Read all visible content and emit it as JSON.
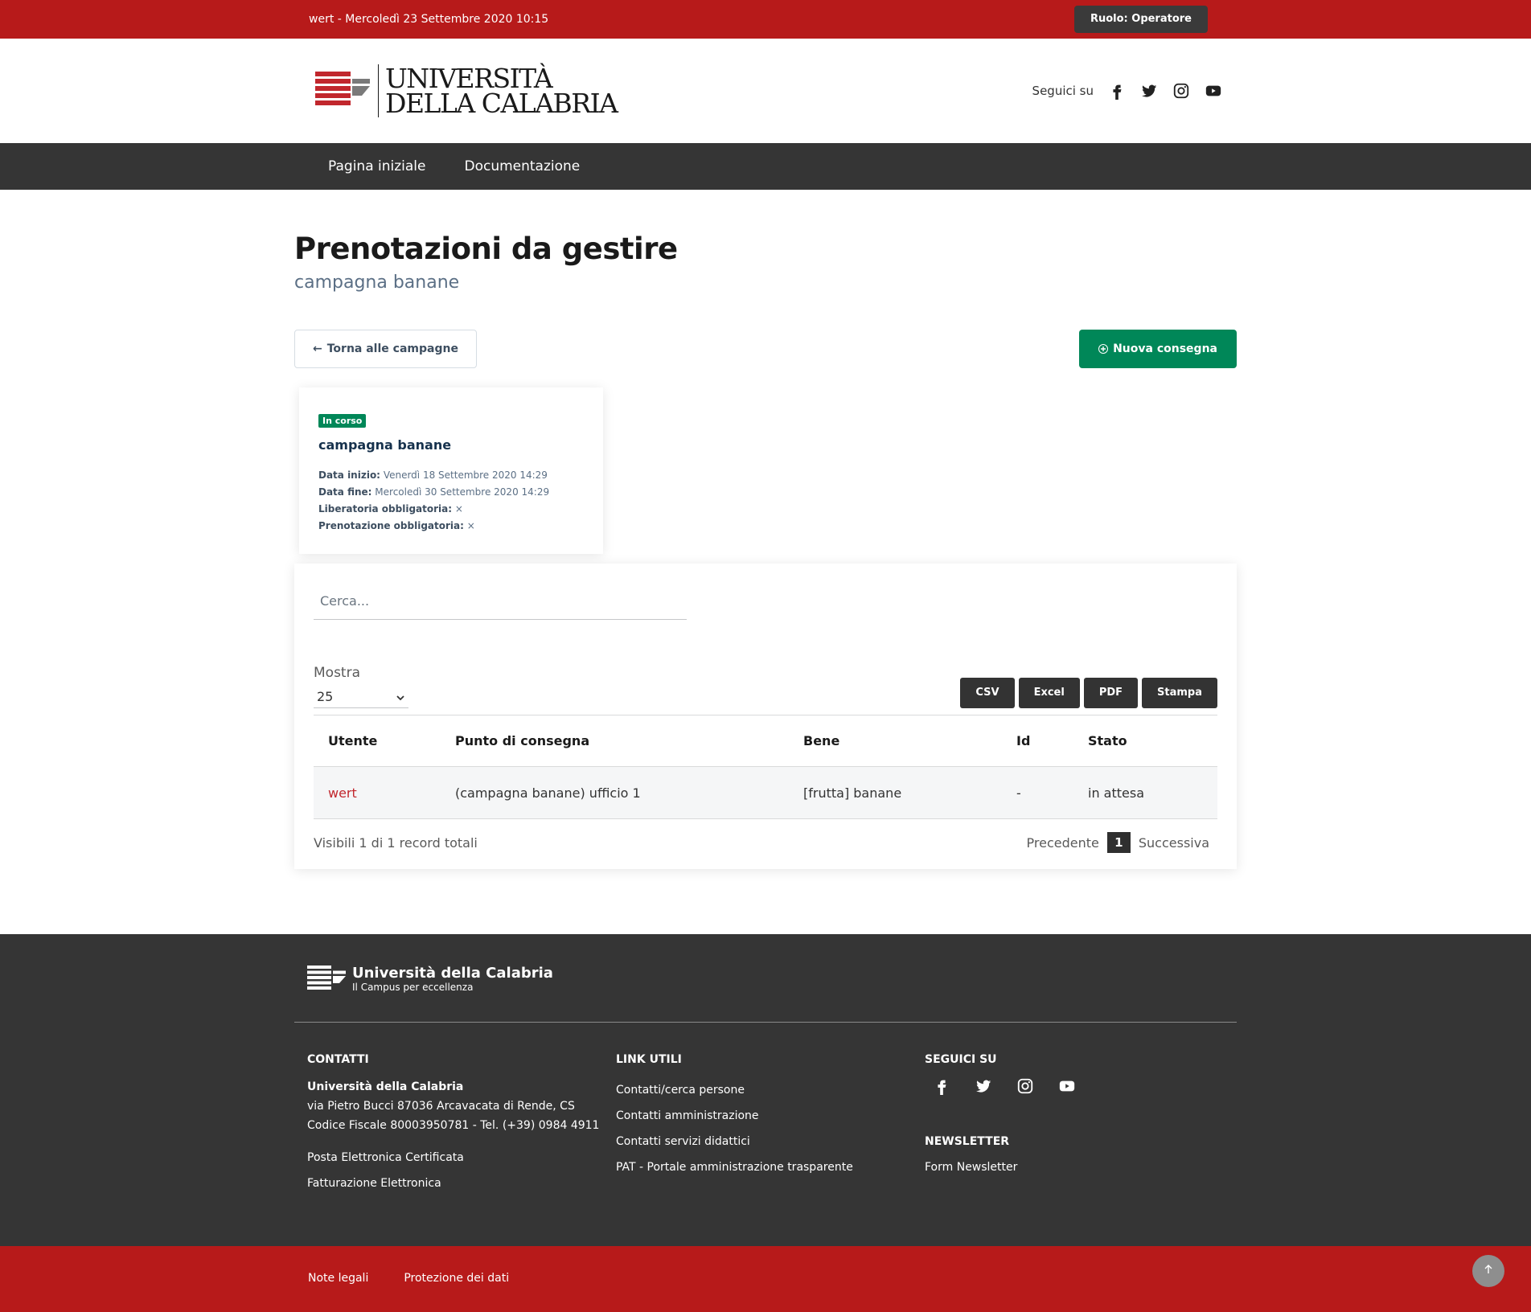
{
  "topbar": {
    "datetime": "wert - Mercoledì 23 Settembre 2020 10:15",
    "role": "Ruolo: Operatore"
  },
  "header": {
    "logo_line1": "UNIVERSITÀ",
    "logo_line2": "DELLA CALABRIA",
    "follow_label": "Seguici su",
    "social_icons": [
      "facebook-icon",
      "twitter-icon",
      "instagram-icon",
      "youtube-icon"
    ]
  },
  "nav": {
    "items": [
      {
        "label": "Pagina iniziale"
      },
      {
        "label": "Documentazione"
      }
    ]
  },
  "page": {
    "title": "Prenotazioni da gestire",
    "subtitle": "campagna banane",
    "back_label": "Torna alle campagne",
    "new_label": "Nuova consegna"
  },
  "campaign": {
    "badge": "In corso",
    "title": "campagna banane",
    "start_label": "Data inizio:",
    "start_value": "Venerdì 18 Settembre 2020 14:29",
    "end_label": "Data fine:",
    "end_value": "Mercoledì 30 Settembre 2020 14:29",
    "liberatoria_label": "Liberatoria obbligatoria:",
    "liberatoria_value": "×",
    "prenotazione_label": "Prenotazione obbligatoria:",
    "prenotazione_value": "×"
  },
  "table": {
    "search_placeholder": "Cerca...",
    "show_label": "Mostra",
    "show_value": "25",
    "export": [
      "CSV",
      "Excel",
      "PDF",
      "Stampa"
    ],
    "columns": [
      "Utente",
      "Punto di consegna",
      "Bene",
      "Id",
      "Stato"
    ],
    "rows": [
      [
        "wert",
        "(campagna banane) ufficio 1",
        "[frutta] banane",
        "-",
        "in attesa"
      ]
    ],
    "info": "Visibili 1 di 1 record totali",
    "prev": "Precedente",
    "page": "1",
    "next": "Successiva"
  },
  "footer": {
    "brand_name": "Università della Calabria",
    "brand_sub": "Il Campus per eccellenza",
    "contacts_title": "CONTATTI",
    "contacts_name": "Università della Calabria",
    "contacts_addr": "via Pietro Bucci 87036 Arcavacata di Rende, CS",
    "contacts_fiscal": "Codice Fiscale 80003950781 - Tel. (+39) 0984 4911",
    "pec": "Posta Elettronica Certificata",
    "fatt": "Fatturazione Elettronica",
    "links_title": "LINK UTILI",
    "links": [
      "Contatti/cerca persone",
      "Contatti amministrazione",
      "Contatti servizi didattici",
      "PAT - Portale amministrazione trasparente"
    ],
    "follow_title": "SEGUICI SU",
    "newsletter_title": "NEWSLETTER",
    "newsletter_link": "Form Newsletter"
  },
  "bottombar": {
    "links": [
      "Note legali",
      "Protezione dei dati"
    ]
  },
  "colors": {
    "brand_red": "#b71a1a",
    "dark": "#353535",
    "green": "#008758",
    "link_red": "#c1272d"
  }
}
